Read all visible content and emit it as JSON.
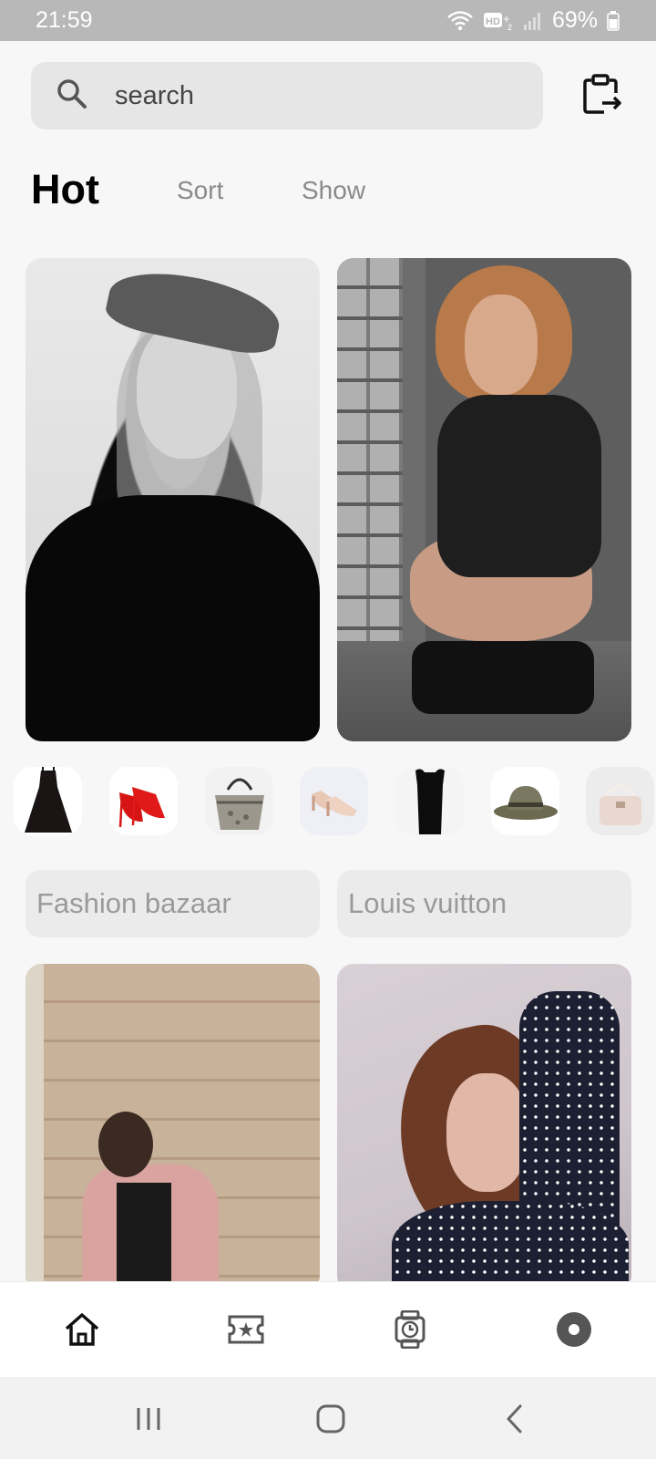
{
  "status_bar": {
    "time": "21:59",
    "battery": "69%",
    "icons": [
      "wifi-icon",
      "hd-voice-icon",
      "signal-icon",
      "battery-icon"
    ]
  },
  "search": {
    "placeholder": "search",
    "icon": "search-icon"
  },
  "header_action": {
    "icon": "clipboard-export-icon"
  },
  "tabs": [
    {
      "label": "Hot",
      "active": true
    },
    {
      "label": "Sort",
      "active": false
    },
    {
      "label": "Show",
      "active": false
    }
  ],
  "featured_photos": [
    {
      "name": "black-white-model-in-cap"
    },
    {
      "name": "model-crouching-by-brick-wall"
    }
  ],
  "products": [
    {
      "icon": "black-dress-icon"
    },
    {
      "icon": "red-heels-icon"
    },
    {
      "icon": "snakeskin-tote-icon"
    },
    {
      "icon": "nude-pumps-icon"
    },
    {
      "icon": "black-slip-dress-icon"
    },
    {
      "icon": "fedora-hat-icon"
    },
    {
      "icon": "pearl-handbag-icon"
    }
  ],
  "brands": [
    {
      "label": "Fashion bazaar"
    },
    {
      "label": "Louis vuitton"
    }
  ],
  "bottom_nav": [
    {
      "icon": "home-icon",
      "active": true
    },
    {
      "icon": "ticket-star-icon",
      "active": false
    },
    {
      "icon": "watch-icon",
      "active": false
    },
    {
      "icon": "profile-disc-icon",
      "active": false
    }
  ],
  "system_nav": [
    "recent-apps-icon",
    "home-button-icon",
    "back-icon"
  ],
  "colors": {
    "background": "#f7f7f7",
    "status_bar": "#b8b8b8",
    "search_bg": "#e6e6e6",
    "chip_bg": "#ebebeb",
    "muted_text": "#8a8a8a",
    "active_text": "#000000"
  }
}
